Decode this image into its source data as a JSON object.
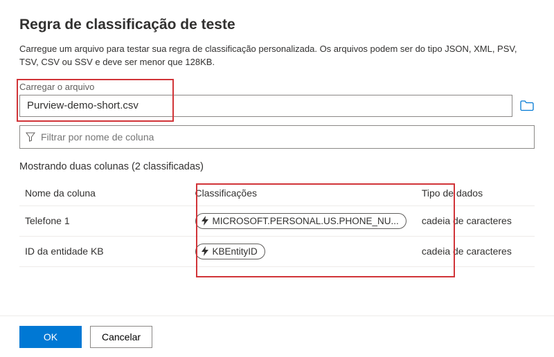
{
  "title": "Regra de classificação de teste",
  "description": "Carregue um arquivo para testar sua regra de classificação personalizada. Os arquivos podem ser do tipo JSON, XML, PSV, TSV, CSV ou SSV e deve ser menor que 128KB.",
  "upload": {
    "label": "Carregar o arquivo",
    "filename": "Purview-demo-short.csv"
  },
  "filter": {
    "placeholder": "Filtrar por nome de coluna"
  },
  "results_heading": "Mostrando duas colunas (2 classificadas)",
  "table": {
    "headers": {
      "column_name": "Nome da coluna",
      "classifications": "Classificações",
      "data_type": "Tipo de dados"
    },
    "rows": [
      {
        "name": "Telefone 1",
        "classification": "MICROSOFT.PERSONAL.US.PHONE_NU...",
        "type": "cadeia de caracteres"
      },
      {
        "name": "ID da entidade KB",
        "classification": "KBEntityID",
        "type": "cadeia de caracteres"
      }
    ]
  },
  "footer": {
    "ok": "OK",
    "cancel": "Cancelar"
  }
}
